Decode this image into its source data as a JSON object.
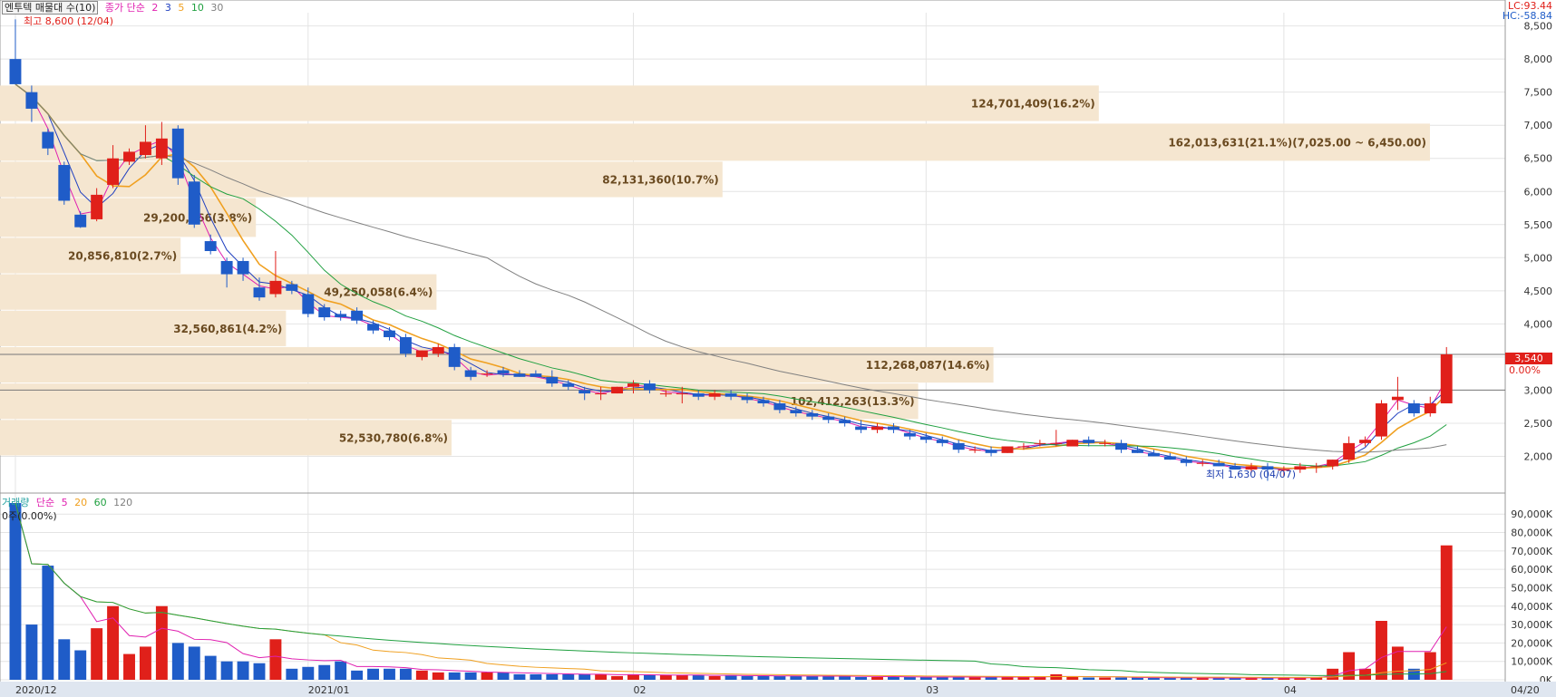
{
  "header": {
    "title": "엔투텍 매물대 수(10)",
    "ma_label": "종가 단순",
    "ma_periods": [
      "2",
      "3",
      "5",
      "10",
      "30"
    ],
    "ma_colors": [
      "#e020b0",
      "#2040c0",
      "#f0a020",
      "#20a040",
      "#808080"
    ],
    "max_label": "최고 8,600 (12/04)",
    "min_label": "최저 1,630 (04/07)",
    "lc": "LC:93.44",
    "hc": "HC:-58.84",
    "current_price": "3,540",
    "current_pct": "0.00%"
  },
  "volume_header": {
    "title": "거래량",
    "ma_label": "단순",
    "ma_periods": [
      "5",
      "20",
      "60",
      "120"
    ],
    "ma_colors": [
      "#e020b0",
      "#f0a020",
      "#20a040",
      "#808080"
    ],
    "pct_label": "0주(0.00%)"
  },
  "colors": {
    "up": "#e0201a",
    "down": "#1f5cc8",
    "band": "#f5e6d0"
  },
  "chart_data": {
    "type": "candlestick",
    "price_axis": {
      "min": 1500,
      "max": 8700,
      "ticks": [
        "8,500",
        "8,000",
        "7,500",
        "7,000",
        "6,500",
        "6,000",
        "5,500",
        "5,000",
        "4,500",
        "4,000",
        "3,500",
        "3,000",
        "2,500",
        "2,000"
      ],
      "tick_values": [
        8500,
        8000,
        7500,
        7000,
        6500,
        6000,
        5500,
        5000,
        4500,
        4000,
        3500,
        3000,
        2500,
        2000
      ]
    },
    "volume_axis": {
      "max": 96000,
      "ticks": [
        "90,000K",
        "80,000K",
        "70,000K",
        "60,000K",
        "50,000K",
        "40,000K",
        "30,000K",
        "20,000K",
        "10,000K",
        "0K"
      ],
      "tick_values": [
        90000,
        80000,
        70000,
        60000,
        50000,
        40000,
        30000,
        20000,
        10000,
        0
      ]
    },
    "x_labels": [
      {
        "label": "2020/12",
        "index": 0
      },
      {
        "label": "2021/01",
        "index": 18
      },
      {
        "label": "02",
        "index": 38
      },
      {
        "label": "03",
        "index": 56
      },
      {
        "label": "04",
        "index": 78
      },
      {
        "label": "04/20",
        "index": 93
      }
    ],
    "volume_profile": [
      {
        "label": "124,701,409(16.2%)",
        "low": 7050,
        "high": 7600,
        "width_frac": 0.73
      },
      {
        "label": "162,013,631(21.1%)(7,025.00 ~ 6,450.00)",
        "low": 6450,
        "high": 7025,
        "width_frac": 0.95
      },
      {
        "label": "82,131,360(10.7%)",
        "low": 5900,
        "high": 6450,
        "width_frac": 0.48
      },
      {
        "label": "29,200,566(3.8%)",
        "low": 5300,
        "high": 5900,
        "width_frac": 0.17
      },
      {
        "label": "20,856,810(2.7%)",
        "low": 4750,
        "high": 5300,
        "width_frac": 0.12
      },
      {
        "label": "49,250,058(6.4%)",
        "low": 4200,
        "high": 4750,
        "width_frac": 0.29
      },
      {
        "label": "32,560,861(4.2%)",
        "low": 3650,
        "high": 4200,
        "width_frac": 0.19
      },
      {
        "label": "112,268,087(14.6%)",
        "low": 3100,
        "high": 3650,
        "width_frac": 0.66
      },
      {
        "label": "102,412,263(13.3%)",
        "low": 2550,
        "high": 3100,
        "width_frac": 0.61
      },
      {
        "label": "52,530,780(6.8%)",
        "low": 2000,
        "high": 2550,
        "width_frac": 0.3
      }
    ],
    "reference_lines": [
      3540,
      3000
    ],
    "candles": [
      [
        8000,
        8600,
        7700,
        7620,
        96000
      ],
      [
        7500,
        7600,
        7050,
        7250,
        30000
      ],
      [
        6900,
        6950,
        6550,
        6650,
        62000
      ],
      [
        6400,
        6450,
        5800,
        5860,
        22000
      ],
      [
        5650,
        5700,
        5450,
        5460,
        16000
      ],
      [
        5580,
        6050,
        5550,
        5950,
        28000
      ],
      [
        6100,
        6700,
        6050,
        6500,
        40000
      ],
      [
        6450,
        6650,
        6400,
        6600,
        14000
      ],
      [
        6550,
        7000,
        6500,
        6750,
        18000
      ],
      [
        6500,
        7050,
        6400,
        6800,
        40000
      ],
      [
        6950,
        7000,
        6100,
        6200,
        20000
      ],
      [
        6150,
        6250,
        5450,
        5500,
        18000
      ],
      [
        5250,
        5350,
        5050,
        5100,
        13000
      ],
      [
        4950,
        5000,
        4550,
        4750,
        10000
      ],
      [
        4950,
        5000,
        4650,
        4750,
        10000
      ],
      [
        4550,
        4700,
        4350,
        4400,
        9000
      ],
      [
        4450,
        5100,
        4400,
        4650,
        22000
      ],
      [
        4600,
        4650,
        4450,
        4500,
        6000
      ],
      [
        4450,
        4550,
        4100,
        4150,
        7000
      ],
      [
        4250,
        4300,
        4050,
        4100,
        8000
      ],
      [
        4150,
        4200,
        4050,
        4100,
        10000
      ],
      [
        4200,
        4250,
        4000,
        4050,
        5000
      ],
      [
        4000,
        4050,
        3850,
        3900,
        6000
      ],
      [
        3900,
        3950,
        3750,
        3800,
        6000
      ],
      [
        3800,
        3850,
        3500,
        3550,
        6000
      ],
      [
        3500,
        3600,
        3450,
        3600,
        5000
      ],
      [
        3550,
        3700,
        3500,
        3650,
        4000
      ],
      [
        3650,
        3700,
        3300,
        3350,
        4000
      ],
      [
        3300,
        3350,
        3150,
        3200,
        4000
      ],
      [
        3250,
        3300,
        3200,
        3250,
        4000
      ],
      [
        3300,
        3350,
        3200,
        3250,
        4000
      ],
      [
        3250,
        3300,
        3200,
        3200,
        3000
      ],
      [
        3250,
        3300,
        3200,
        3200,
        3000
      ],
      [
        3200,
        3300,
        3050,
        3100,
        3000
      ],
      [
        3100,
        3150,
        3000,
        3050,
        3000
      ],
      [
        3000,
        3050,
        2850,
        2950,
        3000
      ],
      [
        2950,
        3050,
        2850,
        2950,
        3000
      ],
      [
        2950,
        3050,
        2950,
        3050,
        2000
      ],
      [
        3050,
        3150,
        2950,
        3100,
        3000
      ],
      [
        3100,
        3150,
        2950,
        3000,
        2500
      ],
      [
        2950,
        3000,
        2900,
        2950,
        2500
      ],
      [
        2950,
        3050,
        2800,
        2950,
        2500
      ],
      [
        2950,
        3000,
        2850,
        2900,
        2500
      ],
      [
        2900,
        3000,
        2850,
        2950,
        2000
      ],
      [
        2950,
        3000,
        2850,
        2900,
        2500
      ],
      [
        2900,
        2950,
        2800,
        2850,
        2000
      ],
      [
        2850,
        2900,
        2750,
        2800,
        2000
      ],
      [
        2800,
        2850,
        2650,
        2700,
        2000
      ],
      [
        2700,
        2750,
        2600,
        2650,
        2000
      ],
      [
        2650,
        2700,
        2550,
        2600,
        2000
      ],
      [
        2600,
        2650,
        2500,
        2550,
        2000
      ],
      [
        2550,
        2600,
        2450,
        2500,
        2000
      ],
      [
        2450,
        2550,
        2350,
        2400,
        1500
      ],
      [
        2400,
        2500,
        2350,
        2450,
        1500
      ],
      [
        2450,
        2500,
        2350,
        2400,
        1500
      ],
      [
        2350,
        2400,
        2250,
        2300,
        1500
      ],
      [
        2300,
        2350,
        2200,
        2250,
        1500
      ],
      [
        2250,
        2300,
        2150,
        2200,
        1500
      ],
      [
        2200,
        2250,
        2050,
        2100,
        1500
      ],
      [
        2100,
        2150,
        2050,
        2100,
        1500
      ],
      [
        2100,
        2150,
        2000,
        2050,
        1500
      ],
      [
        2050,
        2150,
        2050,
        2150,
        1500
      ],
      [
        2150,
        2200,
        2100,
        2150,
        1500
      ],
      [
        2200,
        2250,
        2150,
        2200,
        1500
      ],
      [
        2200,
        2400,
        2150,
        2200,
        3000
      ],
      [
        2150,
        2250,
        2150,
        2250,
        1500
      ],
      [
        2250,
        2300,
        2150,
        2200,
        1200
      ],
      [
        2200,
        2250,
        2150,
        2200,
        1200
      ],
      [
        2200,
        2250,
        2050,
        2100,
        1200
      ],
      [
        2100,
        2150,
        2050,
        2050,
        1200
      ],
      [
        2050,
        2100,
        2000,
        2000,
        1000
      ],
      [
        2000,
        2050,
        1950,
        1950,
        1000
      ],
      [
        1950,
        2000,
        1850,
        1900,
        1000
      ],
      [
        1900,
        1950,
        1850,
        1900,
        1000
      ],
      [
        1900,
        1950,
        1850,
        1850,
        1000
      ],
      [
        1850,
        1900,
        1800,
        1800,
        1000
      ],
      [
        1800,
        1900,
        1750,
        1850,
        1000
      ],
      [
        1850,
        1900,
        1630,
        1800,
        1000
      ],
      [
        1800,
        1850,
        1700,
        1800,
        1000
      ],
      [
        1800,
        1900,
        1750,
        1850,
        1000
      ],
      [
        1850,
        1900,
        1750,
        1850,
        1500
      ],
      [
        1850,
        1950,
        1800,
        1950,
        6000
      ],
      [
        1950,
        2300,
        1900,
        2200,
        15000
      ],
      [
        2200,
        2300,
        2150,
        2250,
        6000
      ],
      [
        2300,
        2850,
        2250,
        2800,
        32000
      ],
      [
        2850,
        3200,
        2700,
        2900,
        18000
      ],
      [
        2800,
        2850,
        2600,
        2650,
        6000
      ],
      [
        2650,
        2900,
        2600,
        2800,
        15000
      ],
      [
        2800,
        3650,
        2800,
        3540,
        73000
      ]
    ]
  }
}
